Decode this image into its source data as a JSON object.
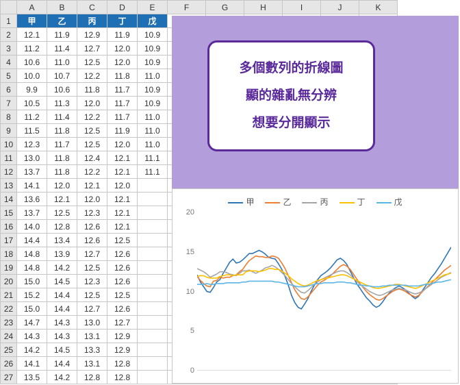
{
  "columns": [
    "A",
    "B",
    "C",
    "D",
    "E",
    "F",
    "G",
    "H",
    "I",
    "J",
    "K"
  ],
  "header_row": [
    "甲",
    "乙",
    "丙",
    "丁",
    "戊"
  ],
  "rows": [
    [
      12.1,
      11.9,
      12.9,
      11.9,
      10.9
    ],
    [
      11.2,
      11.4,
      12.7,
      12.0,
      10.9
    ],
    [
      10.6,
      11.0,
      12.5,
      12.0,
      10.9
    ],
    [
      10.0,
      10.7,
      12.2,
      11.8,
      11.0
    ],
    [
      9.9,
      10.6,
      11.8,
      11.7,
      10.9
    ],
    [
      10.5,
      11.3,
      12.0,
      11.7,
      10.9
    ],
    [
      11.2,
      11.4,
      12.2,
      11.7,
      11.0
    ],
    [
      11.5,
      11.8,
      12.5,
      11.9,
      11.0
    ],
    [
      12.3,
      11.7,
      12.5,
      12.0,
      11.0
    ],
    [
      13.0,
      11.8,
      12.4,
      12.1,
      11.1
    ],
    [
      13.7,
      11.8,
      12.2,
      12.1,
      11.1
    ],
    [
      14.1,
      12.0,
      12.1,
      12.0,
      null
    ],
    [
      13.6,
      12.1,
      12.0,
      12.1,
      null
    ],
    [
      13.7,
      12.5,
      12.3,
      12.1,
      null
    ],
    [
      14.0,
      12.8,
      12.6,
      12.1,
      null
    ],
    [
      14.4,
      13.4,
      12.6,
      12.5,
      null
    ],
    [
      14.8,
      13.9,
      12.7,
      12.6,
      null
    ],
    [
      14.8,
      14.2,
      12.5,
      12.6,
      null
    ],
    [
      15.0,
      14.5,
      12.3,
      12.6,
      null
    ],
    [
      15.2,
      14.4,
      12.5,
      12.5,
      null
    ],
    [
      15.0,
      14.4,
      12.7,
      12.6,
      null
    ],
    [
      14.7,
      14.3,
      13.0,
      12.7,
      null
    ],
    [
      14.3,
      14.3,
      13.1,
      12.9,
      null
    ],
    [
      14.2,
      14.5,
      13.3,
      12.9,
      null
    ],
    [
      14.1,
      14.4,
      13.1,
      12.8,
      null
    ],
    [
      13.5,
      14.2,
      12.8,
      12.8,
      null
    ]
  ],
  "callout": {
    "line1": "多個數列的折線圖",
    "line2": "顯的雜亂無分辨",
    "line3": "想要分開顯示"
  },
  "chart_data": {
    "type": "line",
    "title": "",
    "xlabel": "",
    "ylabel": "",
    "ylim": [
      0,
      20
    ],
    "yticks": [
      0,
      5,
      10,
      15,
      20
    ],
    "legend_position": "top",
    "series": [
      {
        "name": "甲",
        "color": "#2e75b6",
        "values": [
          12.1,
          11.2,
          10.6,
          10.0,
          9.9,
          10.5,
          11.2,
          11.5,
          12.3,
          13.0,
          13.7,
          14.1,
          13.6,
          13.7,
          14.0,
          14.4,
          14.8,
          14.8,
          15.0,
          15.2,
          15.0,
          14.7,
          14.3,
          14.2,
          14.1,
          13.5,
          12.8,
          11.9,
          10.8,
          9.5,
          8.6,
          8.0,
          7.8,
          8.4,
          9.1,
          10.0,
          10.8,
          11.5,
          12.0,
          12.3,
          12.6,
          13.0,
          13.5,
          14.0,
          14.2,
          13.9,
          13.4,
          12.6,
          11.8,
          11.0,
          10.4,
          9.8,
          9.2,
          8.8,
          8.3,
          8.0,
          8.2,
          8.7,
          9.3,
          9.8,
          10.2,
          10.5,
          10.7,
          10.5,
          10.2,
          9.8,
          9.4,
          9.1,
          9.4,
          10.0,
          10.6,
          11.2,
          11.8,
          12.3,
          12.9,
          13.5,
          14.2,
          14.9,
          15.6
        ]
      },
      {
        "name": "乙",
        "color": "#ed7d31",
        "values": [
          11.9,
          11.4,
          11.0,
          10.7,
          10.6,
          11.3,
          11.4,
          11.8,
          11.7,
          11.8,
          11.8,
          12.0,
          12.1,
          12.5,
          12.8,
          13.4,
          13.9,
          14.2,
          14.5,
          14.4,
          14.4,
          14.3,
          14.3,
          14.5,
          14.4,
          14.2,
          13.6,
          12.9,
          12.0,
          11.1,
          10.2,
          9.6,
          9.1,
          9.0,
          9.3,
          9.8,
          10.3,
          10.8,
          11.2,
          11.4,
          11.7,
          12.0,
          12.4,
          12.8,
          13.2,
          13.4,
          13.2,
          12.8,
          12.2,
          11.6,
          11.0,
          10.5,
          10.0,
          9.6,
          9.3,
          9.0,
          8.9,
          9.1,
          9.4,
          9.7,
          10.0,
          10.2,
          10.3,
          10.2,
          10.0,
          9.7,
          9.5,
          9.3,
          9.5,
          9.9,
          10.3,
          10.7,
          11.1,
          11.5,
          11.9,
          12.3,
          12.7,
          13.0,
          13.3
        ]
      },
      {
        "name": "丙",
        "color": "#a5a5a5",
        "values": [
          12.9,
          12.7,
          12.5,
          12.2,
          11.8,
          12.0,
          12.2,
          12.5,
          12.5,
          12.4,
          12.2,
          12.1,
          12.0,
          12.3,
          12.6,
          12.6,
          12.7,
          12.5,
          12.3,
          12.5,
          12.7,
          13.0,
          13.1,
          13.3,
          13.1,
          12.8,
          12.4,
          12.0,
          11.5,
          11.0,
          10.6,
          10.2,
          9.9,
          9.8,
          10.1,
          10.5,
          10.9,
          11.2,
          11.5,
          11.7,
          11.9,
          12.1,
          12.3,
          12.5,
          12.6,
          12.6,
          12.4,
          12.1,
          11.7,
          11.3,
          10.9,
          10.6,
          10.3,
          10.0,
          9.8,
          9.6,
          9.5,
          9.6,
          9.8,
          10.0,
          10.2,
          10.3,
          10.4,
          10.3,
          10.2,
          10.0,
          9.8,
          9.7,
          9.8,
          10.0,
          10.3,
          10.6,
          10.9,
          11.2,
          11.5,
          11.8,
          12.0,
          12.2,
          12.4
        ]
      },
      {
        "name": "丁",
        "color": "#ffc000",
        "values": [
          11.9,
          12.0,
          12.0,
          11.8,
          11.7,
          11.7,
          11.7,
          11.9,
          12.0,
          12.1,
          12.1,
          12.0,
          12.1,
          12.1,
          12.1,
          12.5,
          12.6,
          12.6,
          12.6,
          12.5,
          12.6,
          12.7,
          12.9,
          12.9,
          12.8,
          12.8,
          12.6,
          12.3,
          12.0,
          11.6,
          11.3,
          11.0,
          10.8,
          10.7,
          10.8,
          11.0,
          11.2,
          11.4,
          11.5,
          11.6,
          11.7,
          11.8,
          11.9,
          12.0,
          12.1,
          12.1,
          12.0,
          11.8,
          11.6,
          11.4,
          11.2,
          11.0,
          10.8,
          10.7,
          10.5,
          10.4,
          10.4,
          10.5,
          10.6,
          10.7,
          10.8,
          10.9,
          10.9,
          10.8,
          10.7,
          10.6,
          10.5,
          10.4,
          10.5,
          10.7,
          10.9,
          11.1,
          11.3,
          11.5,
          11.7,
          11.9,
          12.1,
          12.2,
          12.3
        ]
      },
      {
        "name": "戊",
        "color": "#5bb5e8",
        "values": [
          10.9,
          10.9,
          10.9,
          11.0,
          10.9,
          10.9,
          11.0,
          11.0,
          11.0,
          11.1,
          11.1,
          11.1,
          11.1,
          11.1,
          11.2,
          11.2,
          11.3,
          11.3,
          11.3,
          11.3,
          11.3,
          11.3,
          11.3,
          11.3,
          11.2,
          11.2,
          11.1,
          11.0,
          10.9,
          10.8,
          10.7,
          10.6,
          10.6,
          10.6,
          10.7,
          10.8,
          10.9,
          11.0,
          11.0,
          11.1,
          11.1,
          11.1,
          11.1,
          11.2,
          11.2,
          11.2,
          11.1,
          11.1,
          11.0,
          10.9,
          10.8,
          10.8,
          10.7,
          10.7,
          10.6,
          10.6,
          10.6,
          10.7,
          10.7,
          10.8,
          10.8,
          10.8,
          10.8,
          10.8,
          10.8,
          10.7,
          10.7,
          10.7,
          10.7,
          10.8,
          10.9,
          10.9,
          11.0,
          11.1,
          11.2,
          11.2,
          11.3,
          11.4,
          11.5
        ]
      }
    ]
  }
}
